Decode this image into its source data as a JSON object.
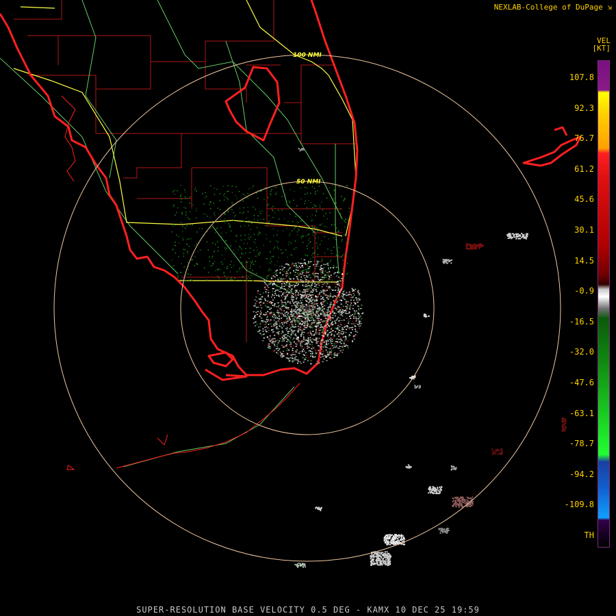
{
  "credit": "NEXLAB-College of DuPage",
  "credit_icon": "external-link-icon",
  "product": "SUPER-RESOLUTION BASE VELOCITY 0.5 DEG - KAMX 10 DEC 25 19:59",
  "legend": {
    "product_code": "VEL",
    "unit": "[KT]",
    "ticks": [
      "107.8",
      "92.3",
      "76.7",
      "61.2",
      "45.6",
      "30.1",
      "14.5",
      "-0.9",
      "-16.5",
      "-32.0",
      "-47.6",
      "-63.1",
      "-78.7",
      "-94.2",
      "-109.8",
      "TH"
    ]
  },
  "range_rings": {
    "inner": "50 NMI",
    "outer": "100 NMI"
  },
  "colors": {
    "coastline": "#ff2020",
    "county": "#b01818",
    "interstate": "#ffff44",
    "highway": "#66cc66",
    "ring": "#f0c8a0",
    "label": "#ffd200",
    "footer": "#c8c8c8"
  }
}
